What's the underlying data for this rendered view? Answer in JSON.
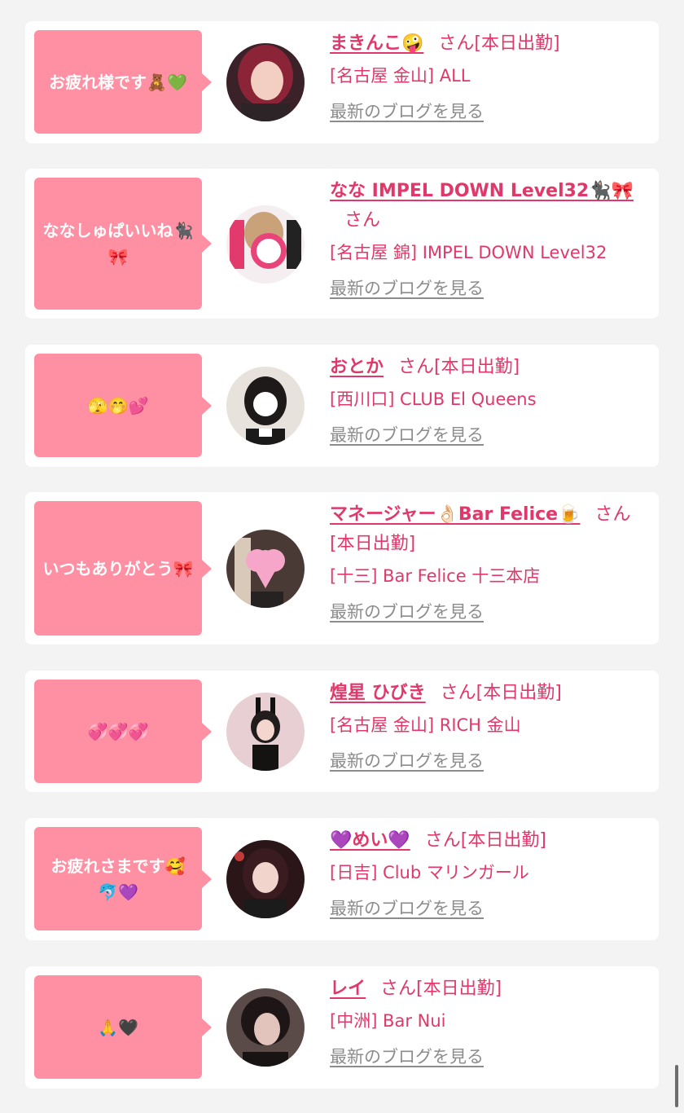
{
  "blog_link_label": "最新のブログを見る",
  "colors": {
    "accent": "#e0386a",
    "bubble": "#ff8fa3",
    "card": "#ffffff",
    "background": "#f3f3f3"
  },
  "cards": [
    {
      "bubble": "お疲れ様です🧸💚",
      "name": "まきんこ🤪",
      "san": "さん[本日出勤]",
      "shop": "[名古屋 金山] ALL",
      "avatar_icon": "avatar-photo"
    },
    {
      "bubble": "ななしゅぱいいね🐈‍⬛🎀",
      "name": "なな IMPEL DOWN Level32🐈‍⬛🎀",
      "san": "さん",
      "shop": "[名古屋 錦] IMPEL DOWN Level32",
      "avatar_icon": "avatar-photo"
    },
    {
      "bubble": "🫣🤭💕",
      "name": "おとか",
      "san": "さん[本日出勤]",
      "shop": "[西川口] CLUB El Queens",
      "avatar_icon": "avatar-photo"
    },
    {
      "bubble": "いつもありがとう🎀",
      "name": "マネージャー👌🏻Bar Felice🍺",
      "san": "さん[本日出勤]",
      "shop": "[十三] Bar Felice 十三本店",
      "avatar_icon": "avatar-photo"
    },
    {
      "bubble": "💞💞💞",
      "name": "煌星 ひびき",
      "san": "さん[本日出勤]",
      "shop": "[名古屋 金山] RICH 金山",
      "avatar_icon": "avatar-photo"
    },
    {
      "bubble": "お疲れさまです🥰🐬💜",
      "name": "💜めい💜",
      "san": "さん[本日出勤]",
      "shop": "[日吉] Club マリンガール",
      "avatar_icon": "avatar-photo"
    },
    {
      "bubble": "🙏🖤",
      "name": "レイ",
      "san": "さん[本日出勤]",
      "shop": "[中洲] Bar Nui",
      "avatar_icon": "avatar-photo"
    }
  ]
}
